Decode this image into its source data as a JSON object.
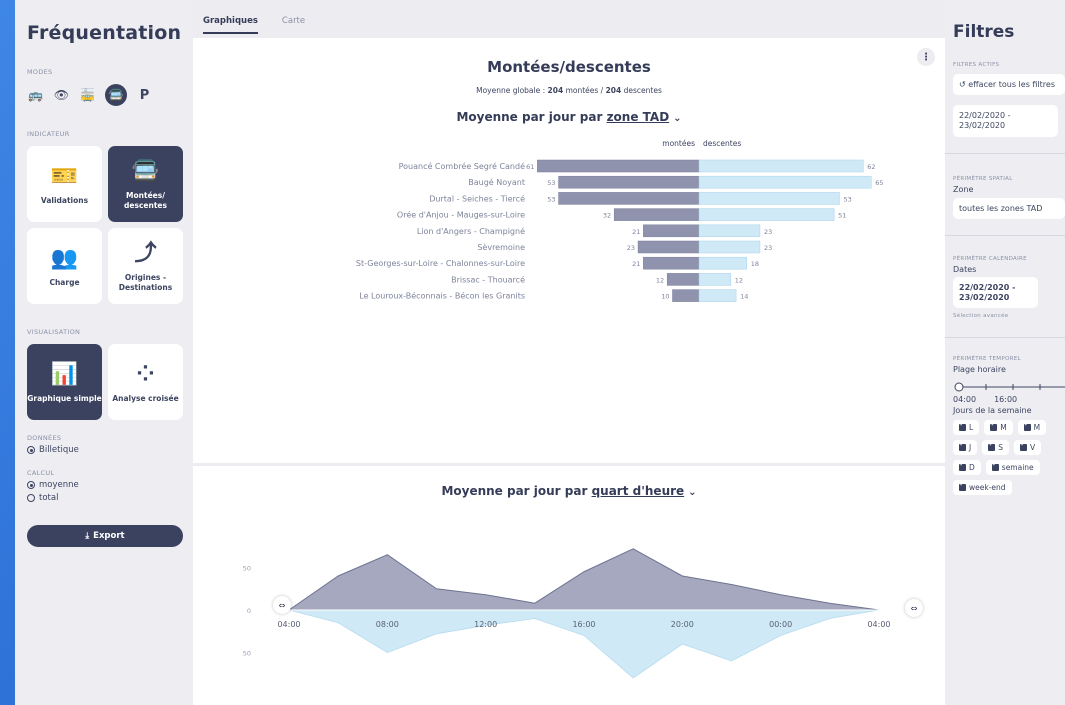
{
  "sidebar": {
    "title": "Fréquentation",
    "modes_label": "MODES",
    "modes": [
      {
        "icon": "bus-icon",
        "glyph": "🚌"
      },
      {
        "icon": "eye-icon",
        "glyph": "👁"
      },
      {
        "icon": "tram-icon",
        "glyph": "🚋"
      },
      {
        "icon": "on-demand-bus-icon",
        "glyph": "🚍"
      },
      {
        "icon": "parking-icon",
        "glyph": "P"
      }
    ],
    "indicator_label": "INDICATEUR",
    "indicators": [
      {
        "label": "Validations",
        "icon": "ticket-icon",
        "glyph": "🎫",
        "active": false
      },
      {
        "label": "Montées/ descentes",
        "icon": "bus-icon",
        "glyph": "🚍",
        "active": true
      },
      {
        "label": "Charge",
        "icon": "people-icon",
        "glyph": "👥",
        "active": false
      },
      {
        "label": "Origines - Destinations",
        "icon": "route-icon",
        "glyph": "⤴",
        "active": false
      }
    ],
    "visualisation_label": "VISUALISATION",
    "visualisations": [
      {
        "label": "Graphique simple",
        "icon": "bar-chart-icon",
        "glyph": "📊",
        "active": true
      },
      {
        "label": "Analyse croisée",
        "icon": "matrix-icon",
        "glyph": "⁘",
        "active": false
      }
    ],
    "data_label": "DONNÉES",
    "data_option": "Billetique",
    "calc_label": "CALCUL",
    "calc_options": [
      "moyenne",
      "total"
    ],
    "export_label": "Export"
  },
  "tabs": [
    "Graphiques",
    "Carte"
  ],
  "top_chart": {
    "title": "Montées/descentes",
    "subtitle_prefix": "Moyenne globale : ",
    "global_up": "204",
    "global_up_label": " montées / ",
    "global_down": "204",
    "global_down_label": " descentes",
    "group_prefix": "Moyenne par jour par ",
    "group_link": "zone TAD",
    "col_up": "montées",
    "col_down": "descentes"
  },
  "bottom_chart": {
    "group_prefix": "Moyenne par jour par ",
    "group_link": "quart d'heure"
  },
  "chart_data": [
    {
      "type": "bar",
      "categories": [
        "Pouancé Combrée Segré Candé",
        "Baugé Noyant",
        "Durtal - Seiches - Tiercé",
        "Orée d'Anjou - Mauges-sur-Loire",
        "Lion d'Angers - Champigné",
        "Sèvremoine",
        "St-Georges-sur-Loire - Chalonnes-sur-Loire",
        "Brissac - Thouarcé",
        "Le Louroux-Béconnais - Bécon les Granits"
      ],
      "series": [
        {
          "name": "montées",
          "values": [
            61,
            53,
            53,
            32,
            21,
            23,
            21,
            12,
            10
          ],
          "color": "#8f93ad"
        },
        {
          "name": "descentes",
          "values": [
            62,
            65,
            53,
            51,
            23,
            23,
            18,
            12,
            14
          ],
          "color": "#cfe9f6"
        }
      ]
    },
    {
      "type": "area",
      "x": [
        "04:00",
        "06:00",
        "08:00",
        "10:00",
        "12:00",
        "14:00",
        "16:00",
        "18:00",
        "20:00",
        "22:00",
        "00:00",
        "02:00",
        "04:00"
      ],
      "x_ticks": [
        "04:00",
        "08:00",
        "12:00",
        "16:00",
        "20:00",
        "00:00",
        "04:00"
      ],
      "y_ticks": [
        "50",
        "0",
        "50"
      ],
      "series": [
        {
          "name": "montées",
          "values": [
            0,
            40,
            65,
            25,
            18,
            8,
            45,
            72,
            40,
            30,
            18,
            8,
            0
          ],
          "color": "#a5a8bf"
        },
        {
          "name": "descentes",
          "values": [
            0,
            -15,
            -50,
            -28,
            -18,
            -10,
            -30,
            -80,
            -40,
            -60,
            -30,
            -10,
            0
          ],
          "color": "#cfe9f6"
        }
      ]
    }
  ],
  "filters": {
    "title": "Filtres",
    "active_label": "FILTRES ACTIFS",
    "clear_label": "effacer tous les filtres",
    "active_dates": "22/02/2020 - 23/02/2020",
    "spatial_label": "PÉRIMÈTRE SPATIAL",
    "zone_label": "Zone",
    "zone_value": "toutes les zones TAD",
    "calendar_label": "PÉRIMÈTRE CALENDAIRE",
    "dates_label": "Dates",
    "dates_value": "22/02/2020 - 23/02/2020",
    "advanced_label": "Sélection avancée",
    "temporal_label": "PÉRIMÈTRE TEMPOREL",
    "time_range_label": "Plage horaire",
    "time_start": "04:00",
    "time_mid": "16:00",
    "days_label": "Jours de la semaine",
    "days": [
      "L",
      "M",
      "M",
      "J",
      "S",
      "V",
      "D",
      "semaine"
    ],
    "weekend_label": "week-end"
  }
}
